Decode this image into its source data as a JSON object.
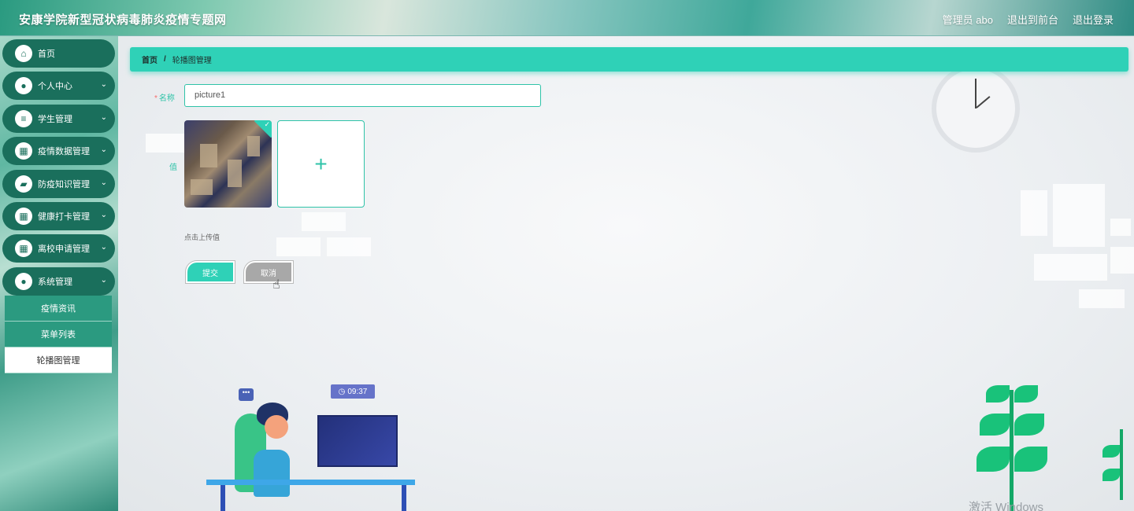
{
  "header": {
    "title": "安康学院新型冠状病毒肺炎疫情专题网",
    "user_label": "管理员 abo",
    "back_front": "退出到前台",
    "logout": "退出登录"
  },
  "sidebar": {
    "items": [
      {
        "label": "首页",
        "icon": "home-icon",
        "glyph": "⌂",
        "has_chevron": false
      },
      {
        "label": "个人中心",
        "icon": "user-icon",
        "glyph": "●",
        "has_chevron": true
      },
      {
        "label": "学生管理",
        "icon": "sliders-icon",
        "glyph": "≡",
        "has_chevron": true
      },
      {
        "label": "疫情数据管理",
        "icon": "grid-icon",
        "glyph": "▦",
        "has_chevron": true
      },
      {
        "label": "防疫知识管理",
        "icon": "wallet-icon",
        "glyph": "▰",
        "has_chevron": true
      },
      {
        "label": "健康打卡管理",
        "icon": "grid-icon",
        "glyph": "▦",
        "has_chevron": true
      },
      {
        "label": "离校申请管理",
        "icon": "grid-icon",
        "glyph": "▦",
        "has_chevron": true
      },
      {
        "label": "系统管理",
        "icon": "bulb-icon",
        "glyph": "●",
        "has_chevron": true
      }
    ],
    "submenu": [
      {
        "label": "疫情资讯",
        "active": false
      },
      {
        "label": "菜单列表",
        "active": false
      },
      {
        "label": "轮播图管理",
        "active": true
      }
    ]
  },
  "breadcrumb": {
    "home": "首页",
    "separator": "/",
    "current": "轮播图管理"
  },
  "form": {
    "name_required_mark": "*",
    "name_label": "名称",
    "name_value": "picture1",
    "value_label": "值",
    "upload_plus": "+",
    "upload_hint": "点击上传值",
    "submit_label": "提交",
    "cancel_label": "取消"
  },
  "illustration": {
    "time": "09:37",
    "chat_glyph": "•••"
  },
  "watermark": "激活 Windows",
  "colors": {
    "accent": "#2fd1b7",
    "sidebar_item": "#1a6f5c",
    "submenu": "#2b9a80",
    "cancel": "#a8a8a8",
    "required": "#f56c6c"
  }
}
